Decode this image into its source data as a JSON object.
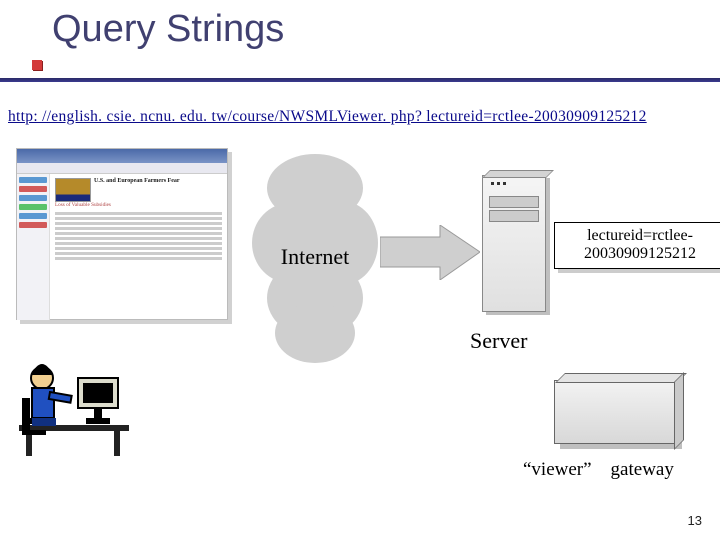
{
  "title": "Query Strings",
  "url": "http: //english. csie. ncnu. edu. tw/course/NWSMLViewer. php? lectureid=rctlee-20030909125212",
  "internet_label": "Internet",
  "server_label": "Server",
  "query_box": {
    "line1": "lectureid=rctlee-",
    "line2": "20030909125212"
  },
  "gateway_label": "“viewer” gateway",
  "page_number": "13",
  "browser_mock": {
    "headline": "U.S. and European Farmers Fear",
    "subhead": "Loss of Valuable Subsidies"
  }
}
